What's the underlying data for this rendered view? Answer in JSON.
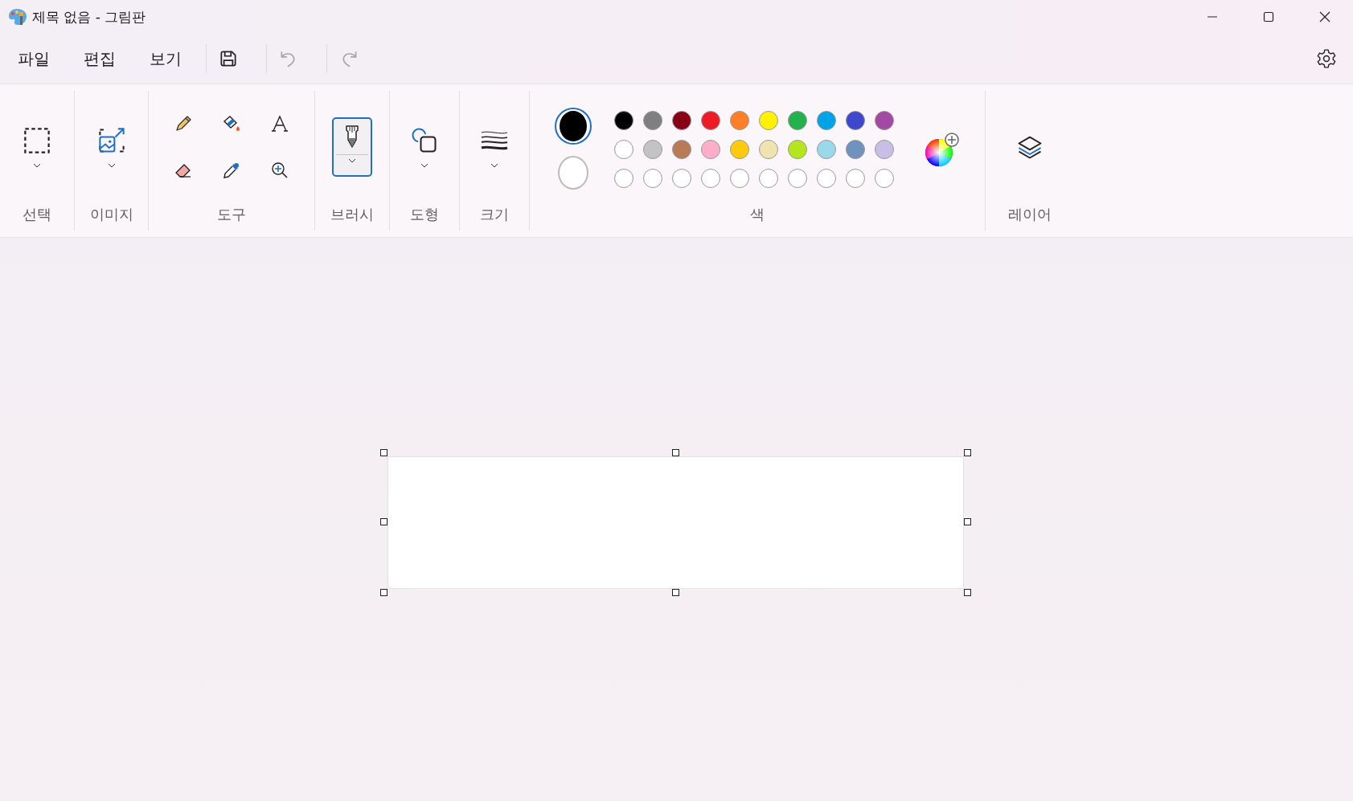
{
  "window": {
    "title": "제목 없음 - 그림판"
  },
  "menu": [
    {
      "label": "파일"
    },
    {
      "label": "편집"
    },
    {
      "label": "보기"
    }
  ],
  "quick_actions": [
    {
      "kind": "save",
      "disabled": false
    },
    {
      "kind": "undo",
      "disabled": true
    },
    {
      "kind": "redo",
      "disabled": true
    }
  ],
  "ribbon": {
    "groups": [
      {
        "kind": "selection",
        "label": "선택",
        "selected": false
      },
      {
        "kind": "image",
        "label": "이미지",
        "selected": false
      },
      {
        "kind": "tools",
        "label": "도구",
        "tools": [
          {
            "kind": "pencil",
            "selected": false
          },
          {
            "kind": "fill",
            "selected": false
          },
          {
            "kind": "text",
            "selected": false
          },
          {
            "kind": "eraser",
            "selected": false
          },
          {
            "kind": "picker",
            "selected": false
          },
          {
            "kind": "magnifier",
            "selected": false
          }
        ]
      },
      {
        "kind": "brushes",
        "label": "브러시",
        "selected": true
      },
      {
        "kind": "shapes",
        "label": "도형",
        "selected": false
      },
      {
        "kind": "size",
        "label": "크기",
        "selected": false
      },
      {
        "kind": "colors",
        "label": "색",
        "current": [
          {
            "color": "#000000",
            "selected": true
          },
          {
            "color": "#ffffff",
            "selected": false
          }
        ],
        "palette": [
          {
            "kind": "color",
            "color": "#000000"
          },
          {
            "kind": "color",
            "color": "#7f7f7f"
          },
          {
            "kind": "color",
            "color": "#880015"
          },
          {
            "kind": "color",
            "color": "#ed1c24"
          },
          {
            "kind": "color",
            "color": "#ff7f27"
          },
          {
            "kind": "color",
            "color": "#fff200"
          },
          {
            "kind": "color",
            "color": "#22b14c"
          },
          {
            "kind": "color",
            "color": "#00a2e8"
          },
          {
            "kind": "color",
            "color": "#3f48cc"
          },
          {
            "kind": "color",
            "color": "#a349a4"
          },
          {
            "kind": "color",
            "color": "#ffffff"
          },
          {
            "kind": "color",
            "color": "#c3c3c3"
          },
          {
            "kind": "color",
            "color": "#b97a57"
          },
          {
            "kind": "color",
            "color": "#ffaec9"
          },
          {
            "kind": "color",
            "color": "#ffc90e"
          },
          {
            "kind": "color",
            "color": "#efe4b0"
          },
          {
            "kind": "color",
            "color": "#b5e61d"
          },
          {
            "kind": "color",
            "color": "#99d9ea"
          },
          {
            "kind": "color",
            "color": "#7092be"
          },
          {
            "kind": "color",
            "color": "#c8bfe7"
          },
          {
            "kind": "empty"
          },
          {
            "kind": "empty"
          },
          {
            "kind": "empty"
          },
          {
            "kind": "empty"
          },
          {
            "kind": "empty"
          },
          {
            "kind": "empty"
          },
          {
            "kind": "empty"
          },
          {
            "kind": "empty"
          },
          {
            "kind": "empty"
          },
          {
            "kind": "empty"
          }
        ]
      },
      {
        "kind": "layers",
        "label": "레이어",
        "selected": false
      }
    ]
  }
}
